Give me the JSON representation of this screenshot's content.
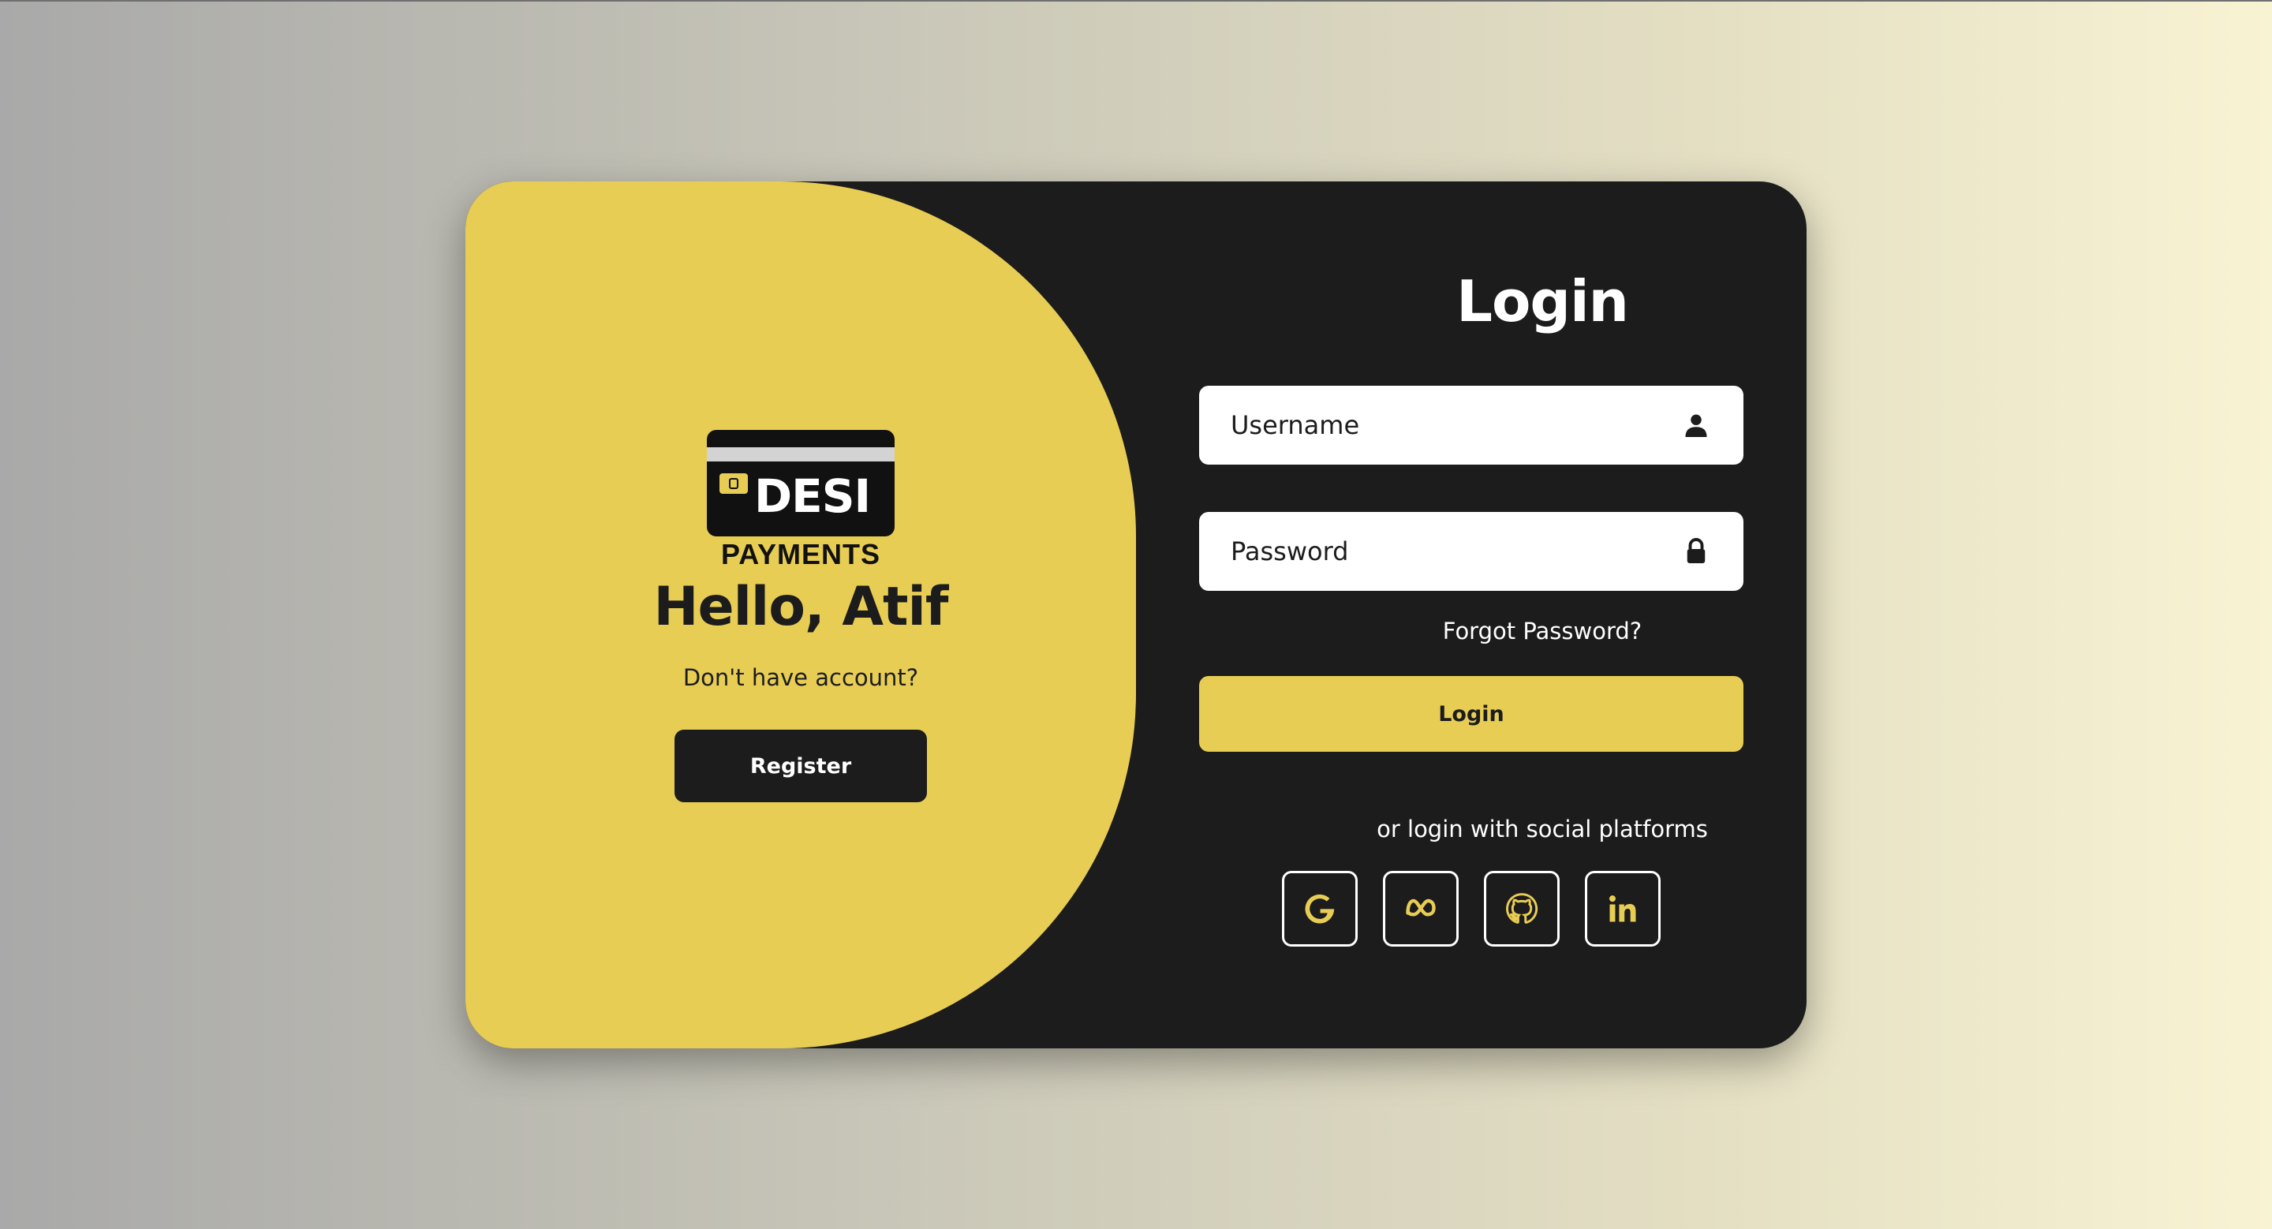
{
  "logo": {
    "brand_line1": "DESI",
    "brand_line2": "PAYMENTS"
  },
  "welcome": {
    "greeting": "Hello, Atif",
    "prompt": "Don't have account?",
    "register_label": "Register"
  },
  "login": {
    "title": "Login",
    "username_placeholder": "Username",
    "password_placeholder": "Password",
    "forgot_label": "Forgot Password?",
    "submit_label": "Login",
    "social_text": "or login with social platforms",
    "social": [
      {
        "name": "google",
        "icon": "google-icon"
      },
      {
        "name": "meta",
        "icon": "meta-icon"
      },
      {
        "name": "github",
        "icon": "github-icon"
      },
      {
        "name": "linkedin",
        "icon": "linkedin-icon"
      }
    ]
  },
  "colors": {
    "accent": "#e8cd55",
    "dark": "#1c1c1c",
    "white": "#ffffff"
  }
}
